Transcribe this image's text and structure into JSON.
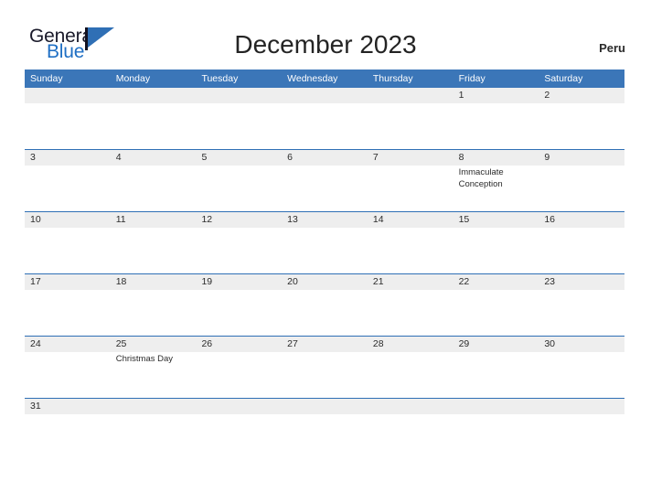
{
  "brand": {
    "name_part1": "General",
    "name_part2": "Blue",
    "flag_icon": "flag-triangle-icon",
    "accent_color": "#1f6fc4"
  },
  "header": {
    "title": "December 2023",
    "country": "Peru"
  },
  "colors": {
    "header_bar": "#3b76b8",
    "week_separator": "#2f6fb5",
    "date_band": "#eeeeee",
    "text": "#2b2b2b",
    "page_background": "#ffffff"
  },
  "calendar": {
    "month": "December",
    "year": "2023",
    "weekday_headers": [
      "Sunday",
      "Monday",
      "Tuesday",
      "Wednesday",
      "Thursday",
      "Friday",
      "Saturday"
    ],
    "weeks": [
      {
        "days": [
          {
            "number": "",
            "events": []
          },
          {
            "number": "",
            "events": []
          },
          {
            "number": "",
            "events": []
          },
          {
            "number": "",
            "events": []
          },
          {
            "number": "",
            "events": []
          },
          {
            "number": "1",
            "events": []
          },
          {
            "number": "2",
            "events": []
          }
        ]
      },
      {
        "days": [
          {
            "number": "3",
            "events": []
          },
          {
            "number": "4",
            "events": []
          },
          {
            "number": "5",
            "events": []
          },
          {
            "number": "6",
            "events": []
          },
          {
            "number": "7",
            "events": []
          },
          {
            "number": "8",
            "events": [
              "Immaculate Conception"
            ]
          },
          {
            "number": "9",
            "events": []
          }
        ]
      },
      {
        "days": [
          {
            "number": "10",
            "events": []
          },
          {
            "number": "11",
            "events": []
          },
          {
            "number": "12",
            "events": []
          },
          {
            "number": "13",
            "events": []
          },
          {
            "number": "14",
            "events": []
          },
          {
            "number": "15",
            "events": []
          },
          {
            "number": "16",
            "events": []
          }
        ]
      },
      {
        "days": [
          {
            "number": "17",
            "events": []
          },
          {
            "number": "18",
            "events": []
          },
          {
            "number": "19",
            "events": []
          },
          {
            "number": "20",
            "events": []
          },
          {
            "number": "21",
            "events": []
          },
          {
            "number": "22",
            "events": []
          },
          {
            "number": "23",
            "events": []
          }
        ]
      },
      {
        "days": [
          {
            "number": "24",
            "events": []
          },
          {
            "number": "25",
            "events": [
              "Christmas Day"
            ]
          },
          {
            "number": "26",
            "events": []
          },
          {
            "number": "27",
            "events": []
          },
          {
            "number": "28",
            "events": []
          },
          {
            "number": "29",
            "events": []
          },
          {
            "number": "30",
            "events": []
          }
        ]
      },
      {
        "short": true,
        "days": [
          {
            "number": "31",
            "events": []
          },
          {
            "number": "",
            "events": []
          },
          {
            "number": "",
            "events": []
          },
          {
            "number": "",
            "events": []
          },
          {
            "number": "",
            "events": []
          },
          {
            "number": "",
            "events": []
          },
          {
            "number": "",
            "events": []
          }
        ]
      }
    ]
  }
}
